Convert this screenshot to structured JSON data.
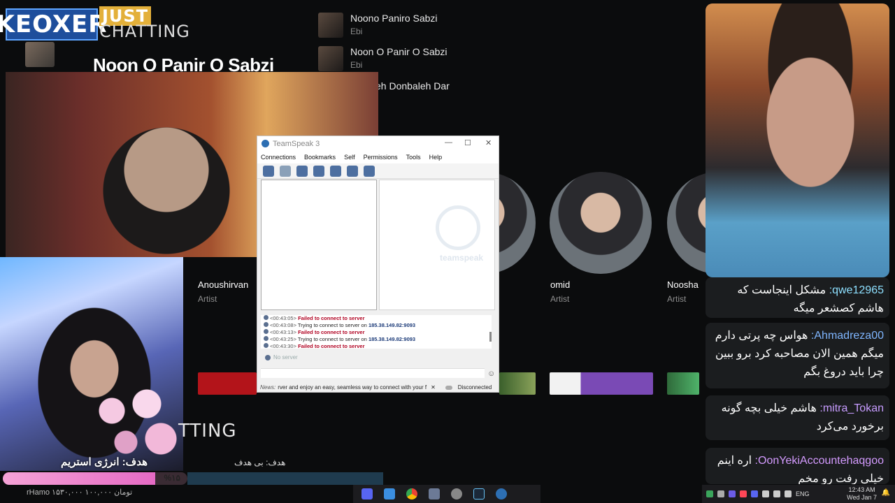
{
  "brand": {
    "name": "KEOXER",
    "sub1": "JUST",
    "sub2": "CHATTING"
  },
  "stream_title": "Noon O Panir O Sabzi",
  "playlist": [
    {
      "title": "Noono Paniro Sabzi",
      "artist": "Ebi"
    },
    {
      "title": "Noon O Panir O Sabzi",
      "artist": "Ebi"
    },
    {
      "title": "eh Donbaleh Dar",
      "artist": ""
    }
  ],
  "artists": [
    {
      "name": "Anoushirvan",
      "role": "Artist"
    },
    {
      "name": "omid",
      "role": "Artist"
    },
    {
      "name": "Noosha",
      "role": "Artist"
    }
  ],
  "overlay": {
    "chatting2": "TTING",
    "goal_label": "هدف: انرژی استریم",
    "goal_percent_text": "%۱۵",
    "goal_fraction": 0.15,
    "goal2_label": "هدف: بی هدف",
    "donation_text": "rHamo ۱۵۳۰,۰۰۰ تومان ۱۰۰,۰۰۰"
  },
  "teamspeak": {
    "title": "TeamSpeak 3",
    "controls": [
      "—",
      "☐",
      "✕"
    ],
    "menu": [
      "Connections",
      "Bookmarks",
      "Self",
      "Permissions",
      "Tools",
      "Help"
    ],
    "watermark": "teamspeak",
    "log": [
      {
        "time": "<00:43:05>",
        "text": "Failed to connect to server",
        "type": "err",
        "ip": ""
      },
      {
        "time": "<00:43:08>",
        "text": "Trying to connect to server on",
        "type": "ok",
        "ip": "185.38.149.82:9093"
      },
      {
        "time": "<00:43:13>",
        "text": "Failed to connect to server",
        "type": "err",
        "ip": ""
      },
      {
        "time": "<00:43:25>",
        "text": "Trying to connect to server on",
        "type": "ok",
        "ip": "185.38.149.82:9093"
      },
      {
        "time": "<00:43:30>",
        "text": "Failed to connect to server",
        "type": "err",
        "ip": ""
      }
    ],
    "server_tab": "No server",
    "news_label": "News:",
    "news_text": "rver and enjoy an easy, seamless way to connect with your f",
    "status": "Disconnected"
  },
  "chat": [
    {
      "user": "qwe12965:",
      "user_color": "#8ee0ff",
      "message": "مشکل اینجاست که هاشم کصشعر میگه"
    },
    {
      "user": "Ahmadreza00:",
      "user_color": "#7fb6ff",
      "message": "هواس چه پرتی دارم میگم همین الان مصاحبه کرد برو ببین چرا باید دروغ بگم"
    },
    {
      "user": "mitra_Tokan:",
      "user_color": "#c79cff",
      "message": "هاشم خیلی بچه گونه برخورد می‌کرد"
    },
    {
      "user": "OonYekiAccountehaqgoo:",
      "user_color": "#d49bff",
      "message": "اره اینم خیلی رفت رو مخم"
    }
  ],
  "taskbar": {
    "lang": "ENG",
    "time": "12:43 AM",
    "date": "Wed Jan 7"
  },
  "colors": {
    "accent": "#e56ac4",
    "ts_error": "#b00020"
  }
}
